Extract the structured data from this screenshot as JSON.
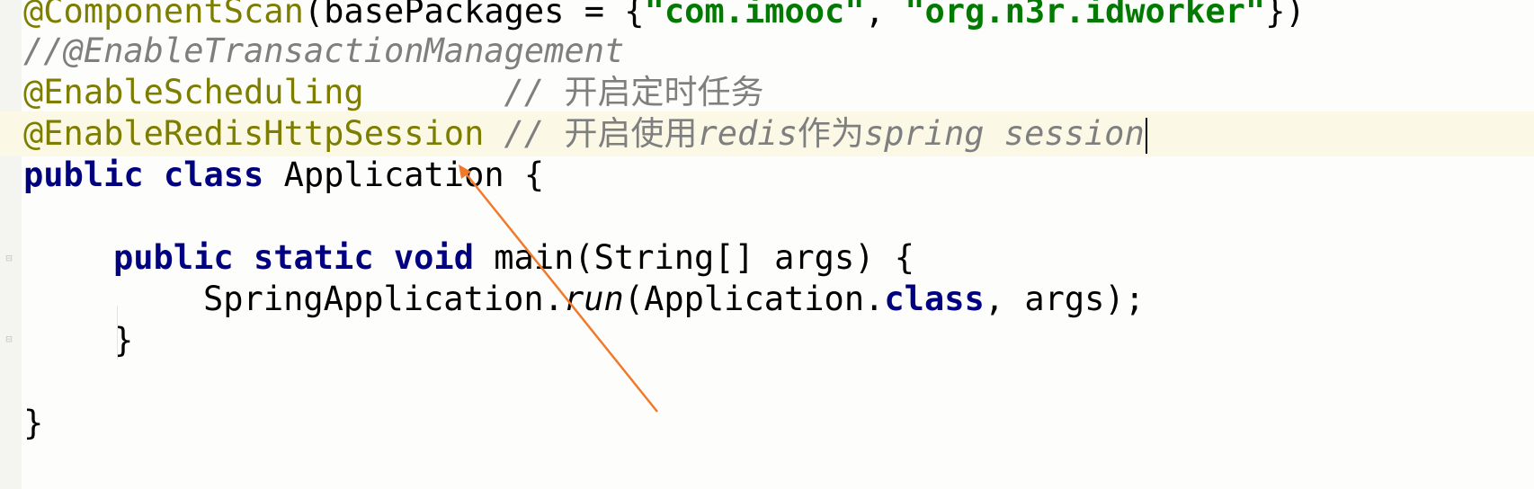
{
  "editor": {
    "lines": [
      {
        "segments": [
          {
            "text": "@ComponentScan",
            "kind": "ann"
          },
          {
            "text": "(basePackages = {",
            "kind": "plain"
          },
          {
            "text": "\"com.imooc\"",
            "kind": "str"
          },
          {
            "text": ", ",
            "kind": "plain"
          },
          {
            "text": "\"org.n3r.idworker\"",
            "kind": "str"
          },
          {
            "text": "})",
            "kind": "plain"
          }
        ]
      },
      {
        "segments": [
          {
            "text": "//@EnableTransactionManagement",
            "kind": "cmt"
          }
        ]
      },
      {
        "segments": [
          {
            "text": "@EnableScheduling",
            "kind": "ann"
          },
          {
            "text": "       // ",
            "kind": "cmt"
          },
          {
            "text": "开启定时任务",
            "kind": "cmt-cjk"
          }
        ]
      },
      {
        "current": true,
        "segments": [
          {
            "text": "@EnableRedisHttpSession",
            "kind": "ann"
          },
          {
            "text": " // ",
            "kind": "cmt"
          },
          {
            "text": "开启使用",
            "kind": "cmt-cjk"
          },
          {
            "text": "redis",
            "kind": "cmt"
          },
          {
            "text": "作为",
            "kind": "cmt-cjk"
          },
          {
            "text": "spring session",
            "kind": "cmt"
          }
        ]
      },
      {
        "segments": [
          {
            "text": "public ",
            "kind": "kw"
          },
          {
            "text": "class ",
            "kind": "kw"
          },
          {
            "text": "Application {",
            "kind": "plain"
          }
        ]
      },
      {
        "segments": []
      },
      {
        "segments": [
          {
            "text": "public ",
            "kind": "kw"
          },
          {
            "text": "static ",
            "kind": "kw"
          },
          {
            "text": "void ",
            "kind": "kw"
          },
          {
            "text": "main(String[] args) {",
            "kind": "plain"
          }
        ]
      },
      {
        "segments": [
          {
            "text": "SpringApplication.",
            "kind": "plain"
          },
          {
            "text": "run",
            "kind": "static-call"
          },
          {
            "text": "(Application.",
            "kind": "plain"
          },
          {
            "text": "class",
            "kind": "kw"
          },
          {
            "text": ", args);",
            "kind": "plain"
          }
        ]
      },
      {
        "segments": [
          {
            "text": "}",
            "kind": "plain"
          }
        ]
      },
      {
        "segments": []
      },
      {
        "segments": [
          {
            "text": "}",
            "kind": "plain"
          }
        ]
      }
    ]
  },
  "annotation": {
    "color": "#f07a2a"
  }
}
